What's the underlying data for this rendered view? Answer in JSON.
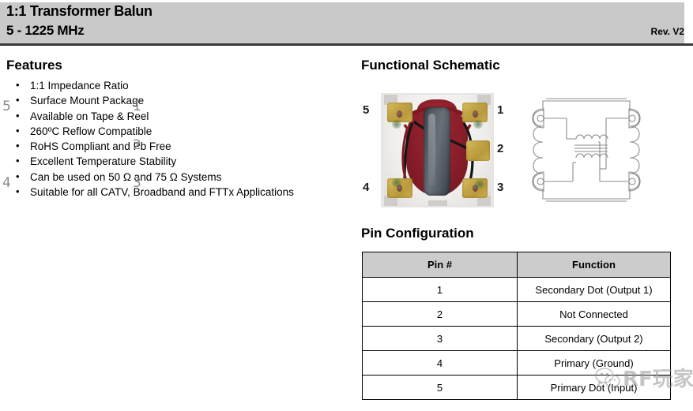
{
  "header": {
    "title": "1:1 Transformer Balun",
    "subtitle": "5 - 1225 MHz",
    "revision": "Rev.  V2"
  },
  "features": {
    "heading": "Features",
    "items": [
      "1:1 Impedance Ratio",
      "Surface Mount Package",
      "Available on Tape & Reel",
      "260ºC Reflow Compatible",
      "RoHS Compliant and Pb Free",
      "Excellent Temperature Stability",
      "Can be used on 50 Ω and 75 Ω Systems",
      "Suitable for all CATV, Broadband and FTTx Applications"
    ]
  },
  "schematic": {
    "heading": "Functional Schematic",
    "photo_pin_labels": {
      "left_top": "5",
      "left_bottom": "4",
      "right_top": "1",
      "right_middle": "2",
      "right_bottom": "3"
    },
    "diagram_pin_labels": {
      "left_top": "5",
      "left_bottom": "4",
      "right_top": "1",
      "right_middle": "2",
      "right_bottom": "3"
    }
  },
  "pin_configuration": {
    "heading": "Pin Configuration",
    "columns": [
      "Pin #",
      "Function"
    ],
    "rows": [
      {
        "pin": "1",
        "function": "Secondary Dot (Output 1)"
      },
      {
        "pin": "2",
        "function": "Not Connected"
      },
      {
        "pin": "3",
        "function": "Secondary (Output 2)"
      },
      {
        "pin": "4",
        "function": "Primary (Ground)"
      },
      {
        "pin": "5",
        "function": "Primary Dot (Input)"
      }
    ]
  },
  "watermark": {
    "text": "RF玩家",
    "logo": "wechat-icon"
  },
  "colors": {
    "header_band": "#c9c9c9",
    "header_rule": "#3a3a3a",
    "table_header_bg": "#cccccc",
    "schematic_line": "#8a8a8a",
    "text": "#000000"
  }
}
